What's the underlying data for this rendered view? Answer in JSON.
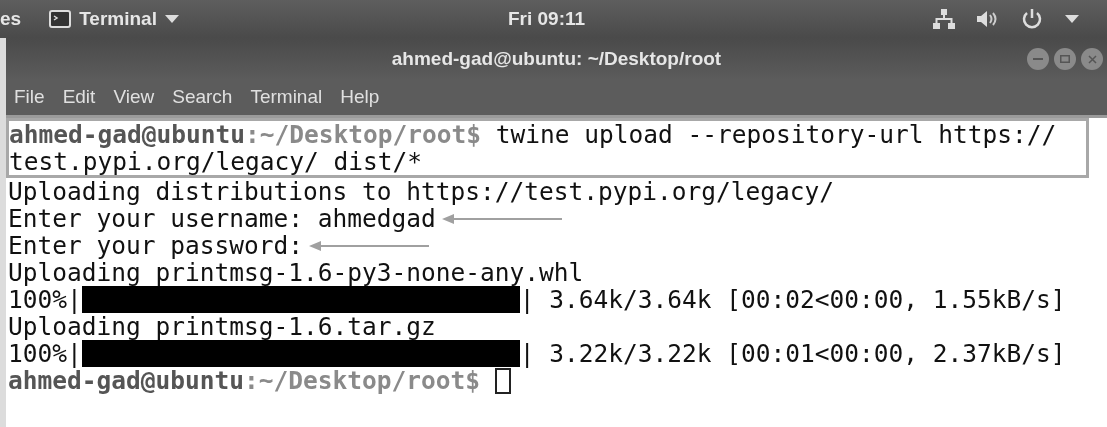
{
  "top_bar": {
    "activities": "es",
    "app_menu": "Terminal",
    "clock": "Fri 09:11"
  },
  "window": {
    "title": "ahmed-gad@ubuntu: ~/Desktop/root"
  },
  "menu": [
    "File",
    "Edit",
    "View",
    "Search",
    "Terminal",
    "Help"
  ],
  "terminal": {
    "lines": [
      {
        "kind": "prompt",
        "user_host": "ahmed-gad@ubuntu",
        "path": ":~/Desktop/root$",
        "command": " twine upload --repository-url https://",
        "highlighted": true
      },
      {
        "kind": "text",
        "text": "test.pypi.org/legacy/ dist/*",
        "highlighted": true
      },
      {
        "kind": "text",
        "text": "Uploading distributions to https://test.pypi.org/legacy/",
        "highlighted": false
      },
      {
        "kind": "annotated",
        "text": "Enter your username: ahmedgad",
        "highlighted": false
      },
      {
        "kind": "annotated",
        "text": "Enter your password:",
        "highlighted": false
      },
      {
        "kind": "text",
        "text": "Uploading printmsg-1.6-py3-none-any.whl",
        "highlighted": false
      },
      {
        "kind": "progress",
        "percent": "100%|",
        "stats": "| 3.64k/3.64k [00:02<00:00, 1.55kB/s]",
        "highlighted": false
      },
      {
        "kind": "text",
        "text": "Uploading printmsg-1.6.tar.gz",
        "highlighted": false
      },
      {
        "kind": "progress",
        "percent": "100%|",
        "stats": "| 3.22k/3.22k [00:01<00:00, 2.37kB/s]",
        "highlighted": false
      },
      {
        "kind": "prompt",
        "user_host": "ahmed-gad@ubuntu",
        "path": ":~/Desktop/root$",
        "highlighted": false,
        "cursor": true
      }
    ]
  }
}
